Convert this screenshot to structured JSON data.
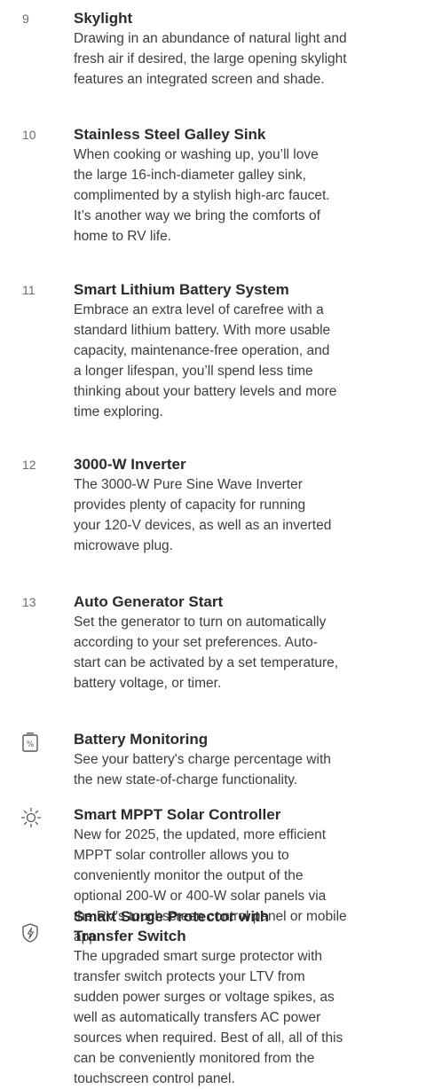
{
  "features": [
    {
      "marker": "9",
      "title": "Skylight",
      "lines": [
        "Drawing in an abundance of natural light and",
        "fresh air if desired, the large opening skylight",
        "features an integrated screen and shade."
      ]
    },
    {
      "marker": "10",
      "title": "Stainless Steel Galley Sink",
      "lines": [
        "When cooking or washing up, you’ll love",
        "the large 16-inch-diameter galley sink,",
        "complimented by a stylish high-arc faucet.",
        "It’s another way we bring the comforts of",
        "home to RV life."
      ]
    },
    {
      "marker": "11",
      "title": "Smart Lithium Battery System",
      "lines": [
        "Embrace an extra level of carefree with a",
        "standard lithium battery. With more usable",
        "capacity, maintenance-free operation, and",
        "a longer lifespan, you’ll spend less time",
        "thinking about your battery levels and more",
        "time exploring."
      ]
    },
    {
      "marker": "12",
      "title": "3000-W Inverter",
      "lines": [
        "The 3000-W Pure Sine Wave Inverter",
        "provides plenty of capacity for running",
        "your 120-V devices, as well as an inverted",
        "microwave plug."
      ]
    },
    {
      "marker": "13",
      "title": "Auto Generator Start",
      "lines": [
        "Set the generator to turn on automatically",
        "according to your set preferences. Auto-",
        "start can be activated by a set temperature,",
        "battery voltage, or timer."
      ]
    },
    {
      "icon": "battery-percent-icon",
      "title": "Battery Monitoring",
      "lines": [
        "See your battery's charge percentage with",
        "the new state-of-charge functionality."
      ]
    },
    {
      "icon": "sun-icon",
      "title": "Smart MPPT Solar Controller",
      "lines": [
        "New for 2025, the updated, more efficient",
        "MPPT solar controller allows you to",
        "conveniently monitor the output of the",
        "optional 200-W or 400-W solar panels via",
        "the RV's touchscreen control panel or mobile",
        "app."
      ]
    },
    {
      "icon": "surge-shield-icon",
      "title_lines": [
        "Smart Surge Protector with",
        "Transfer Switch"
      ],
      "lines": [
        "The upgraded smart surge protector with",
        "transfer switch protects your LTV from",
        "sudden power surges or voltage spikes, as",
        "well as automatically transfers AC power",
        "sources when required. Best of all, all of this",
        "can be conveniently monitored from the",
        "touchscreen control panel."
      ]
    }
  ]
}
